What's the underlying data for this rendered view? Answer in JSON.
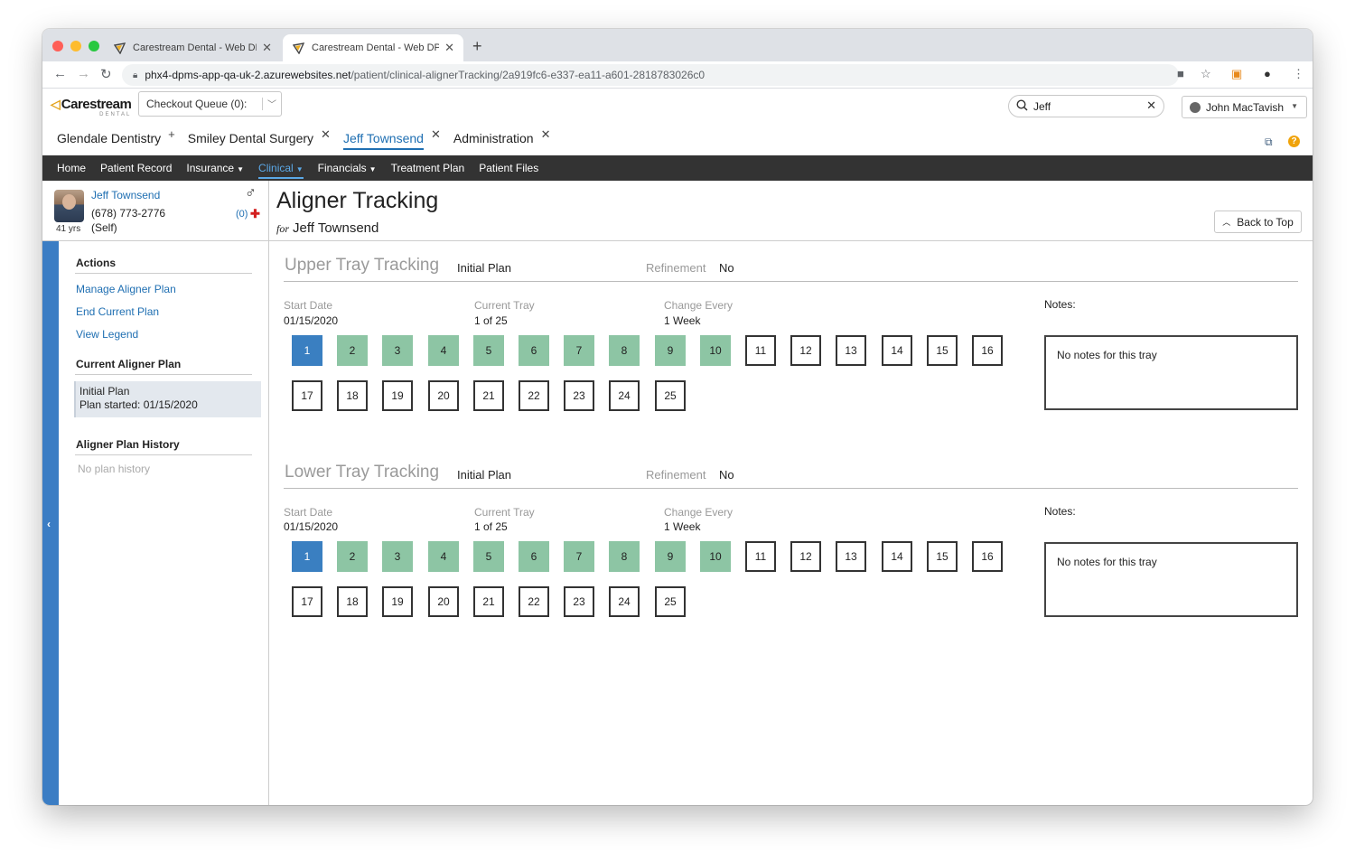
{
  "browser": {
    "tabs": [
      {
        "title": "Carestream Dental - Web DPMS",
        "active": false
      },
      {
        "title": "Carestream Dental - Web DPMS",
        "active": true
      }
    ],
    "new_tab": "+",
    "url_host": "phx4-dpms-app-qa-uk-2.azurewebsites.net",
    "url_path": "/patient/clinical-alignerTracking/2a919fc6-e337-ea11-a601-2818783026c0"
  },
  "header": {
    "logo_text": "Carestream",
    "logo_sub": "DENTAL",
    "queue_label": "Checkout Queue (0):",
    "search_value": "Jeff",
    "user_name": "John MacTavish",
    "tabs": [
      {
        "label": "Glendale Dentistry",
        "icon": "+"
      },
      {
        "label": "Smiley Dental Surgery",
        "icon": "✕"
      },
      {
        "label": "Jeff Townsend",
        "icon": "✕",
        "active": true
      },
      {
        "label": "Administration",
        "icon": "✕"
      }
    ]
  },
  "menu": [
    {
      "label": "Home"
    },
    {
      "label": "Patient Record"
    },
    {
      "label": "Insurance",
      "dropdown": true
    },
    {
      "label": "Clinical",
      "dropdown": true,
      "active": true
    },
    {
      "label": "Financials",
      "dropdown": true
    },
    {
      "label": "Treatment Plan"
    },
    {
      "label": "Patient Files"
    }
  ],
  "patient": {
    "name": "Jeff Townsend",
    "phone": "(678) 773-2776",
    "relation": "(Self)",
    "age": "41 yrs",
    "alerts": "(0)",
    "gender_icon": "♂"
  },
  "page": {
    "title": "Aligner Tracking",
    "for_label": "for",
    "for_name": "Jeff Townsend",
    "back_to_top": "Back to Top"
  },
  "sidebar": {
    "actions_header": "Actions",
    "actions": [
      "Manage Aligner Plan",
      "End Current Plan",
      "View Legend"
    ],
    "current_header": "Current Aligner Plan",
    "current_plan_name": "Initial Plan",
    "current_plan_started": "Plan started: 01/15/2020",
    "history_header": "Aligner Plan History",
    "history_empty": "No plan history"
  },
  "labels": {
    "refinement": "Refinement",
    "start_date": "Start Date",
    "current_tray": "Current Tray",
    "change_every": "Change Every",
    "notes": "Notes:"
  },
  "sections": [
    {
      "title": "Upper Tray Tracking",
      "plan": "Initial Plan",
      "refinement": "No",
      "start_date": "01/15/2020",
      "current_tray": "1 of 25",
      "change_every": "1 Week",
      "notes": "No notes for this tray",
      "total_trays": 25,
      "current_index": 1,
      "completed_through": 10
    },
    {
      "title": "Lower Tray Tracking",
      "plan": "Initial Plan",
      "refinement": "No",
      "start_date": "01/15/2020",
      "current_tray": "1 of 25",
      "change_every": "1 Week",
      "notes": "No notes for this tray",
      "total_trays": 25,
      "current_index": 1,
      "completed_through": 10
    }
  ],
  "colors": {
    "current_tray": "#3a7fc1",
    "completed_tray": "#8dc5a4",
    "menu_bar": "#333333",
    "link": "#1f6fb2",
    "sidebar_collapse": "#3b7dc4"
  }
}
